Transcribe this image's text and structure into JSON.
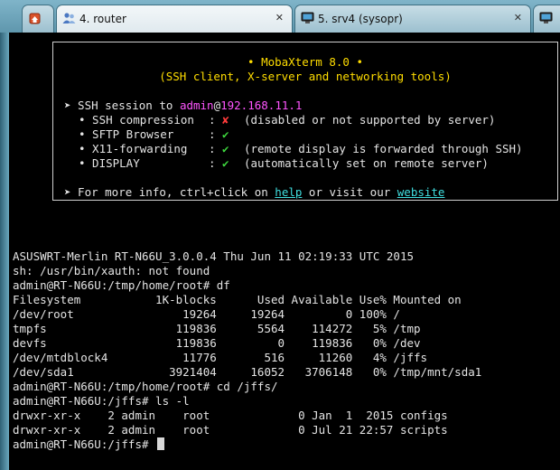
{
  "tabs": [
    {
      "label": "",
      "icon": "home-icon"
    },
    {
      "label": "4. router",
      "icon": "users-icon",
      "active": true
    },
    {
      "label": "5. srv4 (sysopr)",
      "icon": "monitor-icon"
    },
    {
      "label": "",
      "icon": "monitor-icon"
    }
  ],
  "banner": {
    "title": "• MobaXterm 8.0 •",
    "subtitle": "(SSH client, X-server and networking tools)",
    "session_prefix": "➤ SSH session to ",
    "user": "admin",
    "at": "@",
    "host": "192.168.11.1",
    "features": [
      {
        "name": "• SSH compression",
        "sep": ":",
        "mark": "✘",
        "note": "(disabled or not supported by server)"
      },
      {
        "name": "• SFTP Browser",
        "sep": ":",
        "mark": "✔",
        "note": ""
      },
      {
        "name": "• X11-forwarding",
        "sep": ":",
        "mark": "✔",
        "note": "(remote display is forwarded through SSH)"
      },
      {
        "name": "• DISPLAY",
        "sep": ":",
        "mark": "✔",
        "note": "(automatically set on remote server)"
      }
    ],
    "info_prefix": "➤ For more info, ctrl+click on ",
    "help_link": "help",
    "info_mid": " or visit our ",
    "website_link": "website"
  },
  "output": [
    "ASUSWRT-Merlin RT-N66U_3.0.0.4 Thu Jun 11 02:19:33 UTC 2015",
    "sh: /usr/bin/xauth: not found",
    "admin@RT-N66U:/tmp/home/root# df",
    "Filesystem           1K-blocks      Used Available Use% Mounted on",
    "/dev/root                19264     19264         0 100% /",
    "tmpfs                   119836      5564    114272   5% /tmp",
    "devfs                   119836         0    119836   0% /dev",
    "/dev/mtdblock4           11776       516     11260   4% /jffs",
    "/dev/sda1              3921404     16052   3706148   0% /tmp/mnt/sda1",
    "admin@RT-N66U:/tmp/home/root# cd /jffs/",
    "admin@RT-N66U:/jffs# ls -l",
    "drwxr-xr-x    2 admin    root             0 Jan  1  2015 configs",
    "drwxr-xr-x    2 admin    root             0 Jul 21 22:57 scripts"
  ],
  "prompt": "admin@RT-N66U:/jffs# ",
  "colors": {
    "banner_title": "#ffdd00",
    "user": "#ff55ff",
    "check": "#3ed63e",
    "cross": "#ff3b3b",
    "link": "#40dfe0"
  }
}
